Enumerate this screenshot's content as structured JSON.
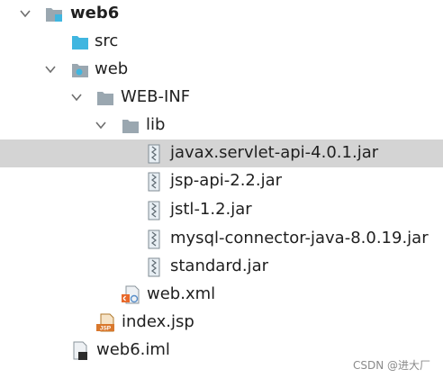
{
  "tree": {
    "items": [
      {
        "label": "web6",
        "icon": "module-folder-icon"
      },
      {
        "label": "src",
        "icon": "source-folder-icon"
      },
      {
        "label": "web",
        "icon": "web-folder-icon"
      },
      {
        "label": "WEB-INF",
        "icon": "folder-icon"
      },
      {
        "label": "lib",
        "icon": "folder-icon"
      },
      {
        "label": "javax.servlet-api-4.0.1.jar",
        "icon": "jar-icon"
      },
      {
        "label": "jsp-api-2.2.jar",
        "icon": "jar-icon"
      },
      {
        "label": "jstl-1.2.jar",
        "icon": "jar-icon"
      },
      {
        "label": "mysql-connector-java-8.0.19.jar",
        "icon": "jar-icon"
      },
      {
        "label": "standard.jar",
        "icon": "jar-icon"
      },
      {
        "label": "web.xml",
        "icon": "xml-file-icon"
      },
      {
        "label": "index.jsp",
        "icon": "jsp-file-icon"
      },
      {
        "label": "web6.iml",
        "icon": "iml-file-icon"
      }
    ],
    "selected_label": "javax.servlet-api-4.0.1.jar"
  },
  "watermark": "CSDN @进大厂",
  "colors": {
    "selection": "#d4d4d4",
    "folder": "#9aa7b0",
    "source_folder": "#40b6e0",
    "chevron": "#6e6e6e"
  }
}
